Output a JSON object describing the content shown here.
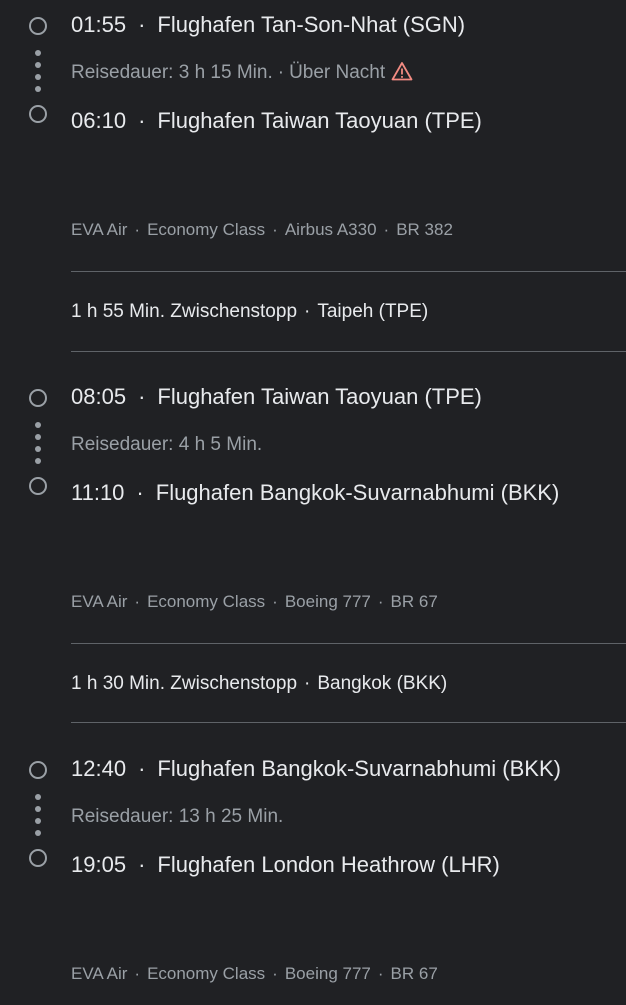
{
  "separator": "·",
  "segments": [
    {
      "departure": {
        "time": "01:55",
        "airport": "Flughafen Tan-Son-Nhat (SGN)"
      },
      "duration": "Reisedauer: 3 h 15 Min.",
      "overnight": "Über Nacht",
      "warning_icon": "warning-triangle-icon",
      "warning_color": "#f28b82",
      "arrival": {
        "time": "06:10",
        "airport": "Flughafen Taiwan Taoyuan (TPE)"
      },
      "details": {
        "airline": "EVA Air",
        "class": "Economy Class",
        "aircraft": "Airbus A330",
        "flight": "BR 382"
      }
    },
    {
      "departure": {
        "time": "08:05",
        "airport": "Flughafen Taiwan Taoyuan (TPE)"
      },
      "duration": "Reisedauer: 4 h 5 Min.",
      "arrival": {
        "time": "11:10",
        "airport": "Flughafen Bangkok-Suvarnabhumi (BKK)"
      },
      "details": {
        "airline": "EVA Air",
        "class": "Economy Class",
        "aircraft": "Boeing 777",
        "flight": "BR 67"
      }
    },
    {
      "departure": {
        "time": "12:40",
        "airport": "Flughafen Bangkok-Suvarnabhumi (BKK)"
      },
      "duration": "Reisedauer: 13 h 25 Min.",
      "arrival": {
        "time": "19:05",
        "airport": "Flughafen London Heathrow (LHR)"
      },
      "details": {
        "airline": "EVA Air",
        "class": "Economy Class",
        "aircraft": "Boeing 777",
        "flight": "BR 67"
      }
    }
  ],
  "layovers": [
    {
      "duration": "1 h 55 Min. Zwischenstopp",
      "place": "Taipeh (TPE)"
    },
    {
      "duration": "1 h 30 Min. Zwischenstopp",
      "place": "Bangkok (BKK)"
    }
  ]
}
